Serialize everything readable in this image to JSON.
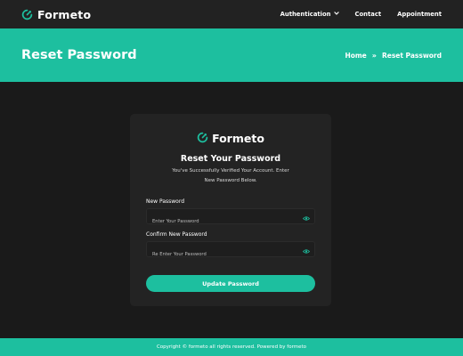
{
  "navbar": {
    "brand_name": "Formeto",
    "links": [
      {
        "label": "Authentication",
        "has_dropdown": true
      },
      {
        "label": "Contact"
      },
      {
        "label": "Appointment"
      }
    ]
  },
  "banner": {
    "title": "Reset Password",
    "breadcrumb": {
      "home": "Home",
      "separator": "»",
      "current": "Reset Password"
    }
  },
  "card": {
    "brand_name": "Formeto",
    "title": "Reset Your Password",
    "description": "You've Successfully Verified Your Account. Enter New Password Below.",
    "fields": [
      {
        "label": "New Password",
        "placeholder": "Enter Your Password",
        "icon": "eye-icon"
      },
      {
        "label": "Confirm New Password",
        "placeholder": "Re Enter Your Password",
        "icon": "eye-icon"
      }
    ],
    "submit_label": "Update Password"
  },
  "footer": {
    "text": "Copyright © formeto all rights reserved. Powered by formeto"
  },
  "colors": {
    "accent": "#1dbf9f",
    "page_bg": "#1a1a1a",
    "navbar_bg": "#222222",
    "card_bg": "#232323"
  }
}
